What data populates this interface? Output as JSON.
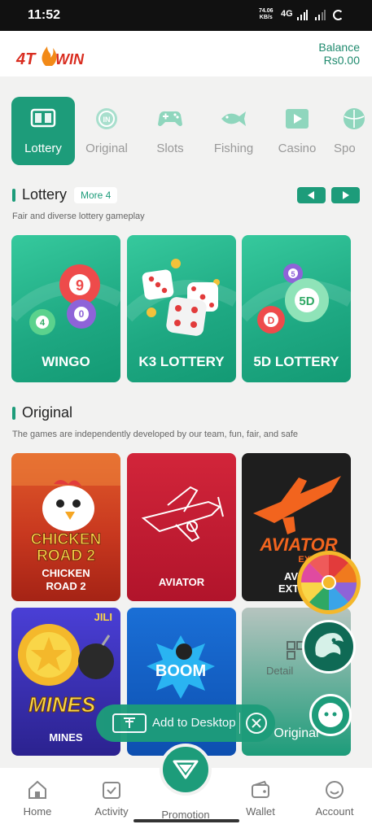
{
  "status_bar": {
    "time": "11:52",
    "net_speed": "74.06",
    "net_unit": "KB/s",
    "network": "4G"
  },
  "header": {
    "logo_text": "4T WIN",
    "balance_label": "Balance",
    "balance_value": "Rs0.00"
  },
  "categories": [
    {
      "label": "Lottery",
      "icon": "lottery-icon",
      "active": true
    },
    {
      "label": "Original",
      "icon": "original-icon"
    },
    {
      "label": "Slots",
      "icon": "gamepad-icon"
    },
    {
      "label": "Fishing",
      "icon": "fish-icon"
    },
    {
      "label": "Casino",
      "icon": "casino-play-icon"
    },
    {
      "label": "Spo",
      "icon": "sports-ball-icon"
    }
  ],
  "lottery_section": {
    "title": "Lottery",
    "more": "More 4",
    "description": "Fair and diverse lottery gameplay",
    "cards": [
      {
        "name": "WINGO",
        "balls": [
          "9",
          "0",
          "4"
        ]
      },
      {
        "name": "K3 LOTTERY"
      },
      {
        "name": "5D LOTTERY",
        "balls": [
          "5",
          "5D",
          "D"
        ]
      }
    ]
  },
  "original_section": {
    "title": "Original",
    "description": "The games are independently developed by our team, fun, fair, and safe",
    "cards": [
      {
        "name": "CHICKEN ROAD 2",
        "art_line1": "CHICKEN",
        "art_line2": "ROAD 2",
        "caption_line1": "CHICKEN",
        "caption_line2": "ROAD 2"
      },
      {
        "name": "AVIATOR"
      },
      {
        "name": "AVIATOR EXTRA",
        "art_line1": "AVIATOR",
        "art_line2": "EXTRA",
        "caption_line1": "AVIA",
        "caption_line2": "EXTRA"
      },
      {
        "name": "MINES",
        "badge": "JILI",
        "art_text": "MINES"
      },
      {
        "name": "BOOM"
      },
      {
        "name": "Original",
        "detail": "Detail"
      }
    ]
  },
  "add_to_desktop": {
    "label": "Add to Desktop"
  },
  "bottom_nav": {
    "home": "Home",
    "activity": "Activity",
    "promotion": "Promotion",
    "wallet": "Wallet",
    "account": "Account"
  },
  "colors": {
    "accent": "#1d9c7a",
    "background": "#f2f2f1",
    "logo_red": "#d92d20"
  }
}
